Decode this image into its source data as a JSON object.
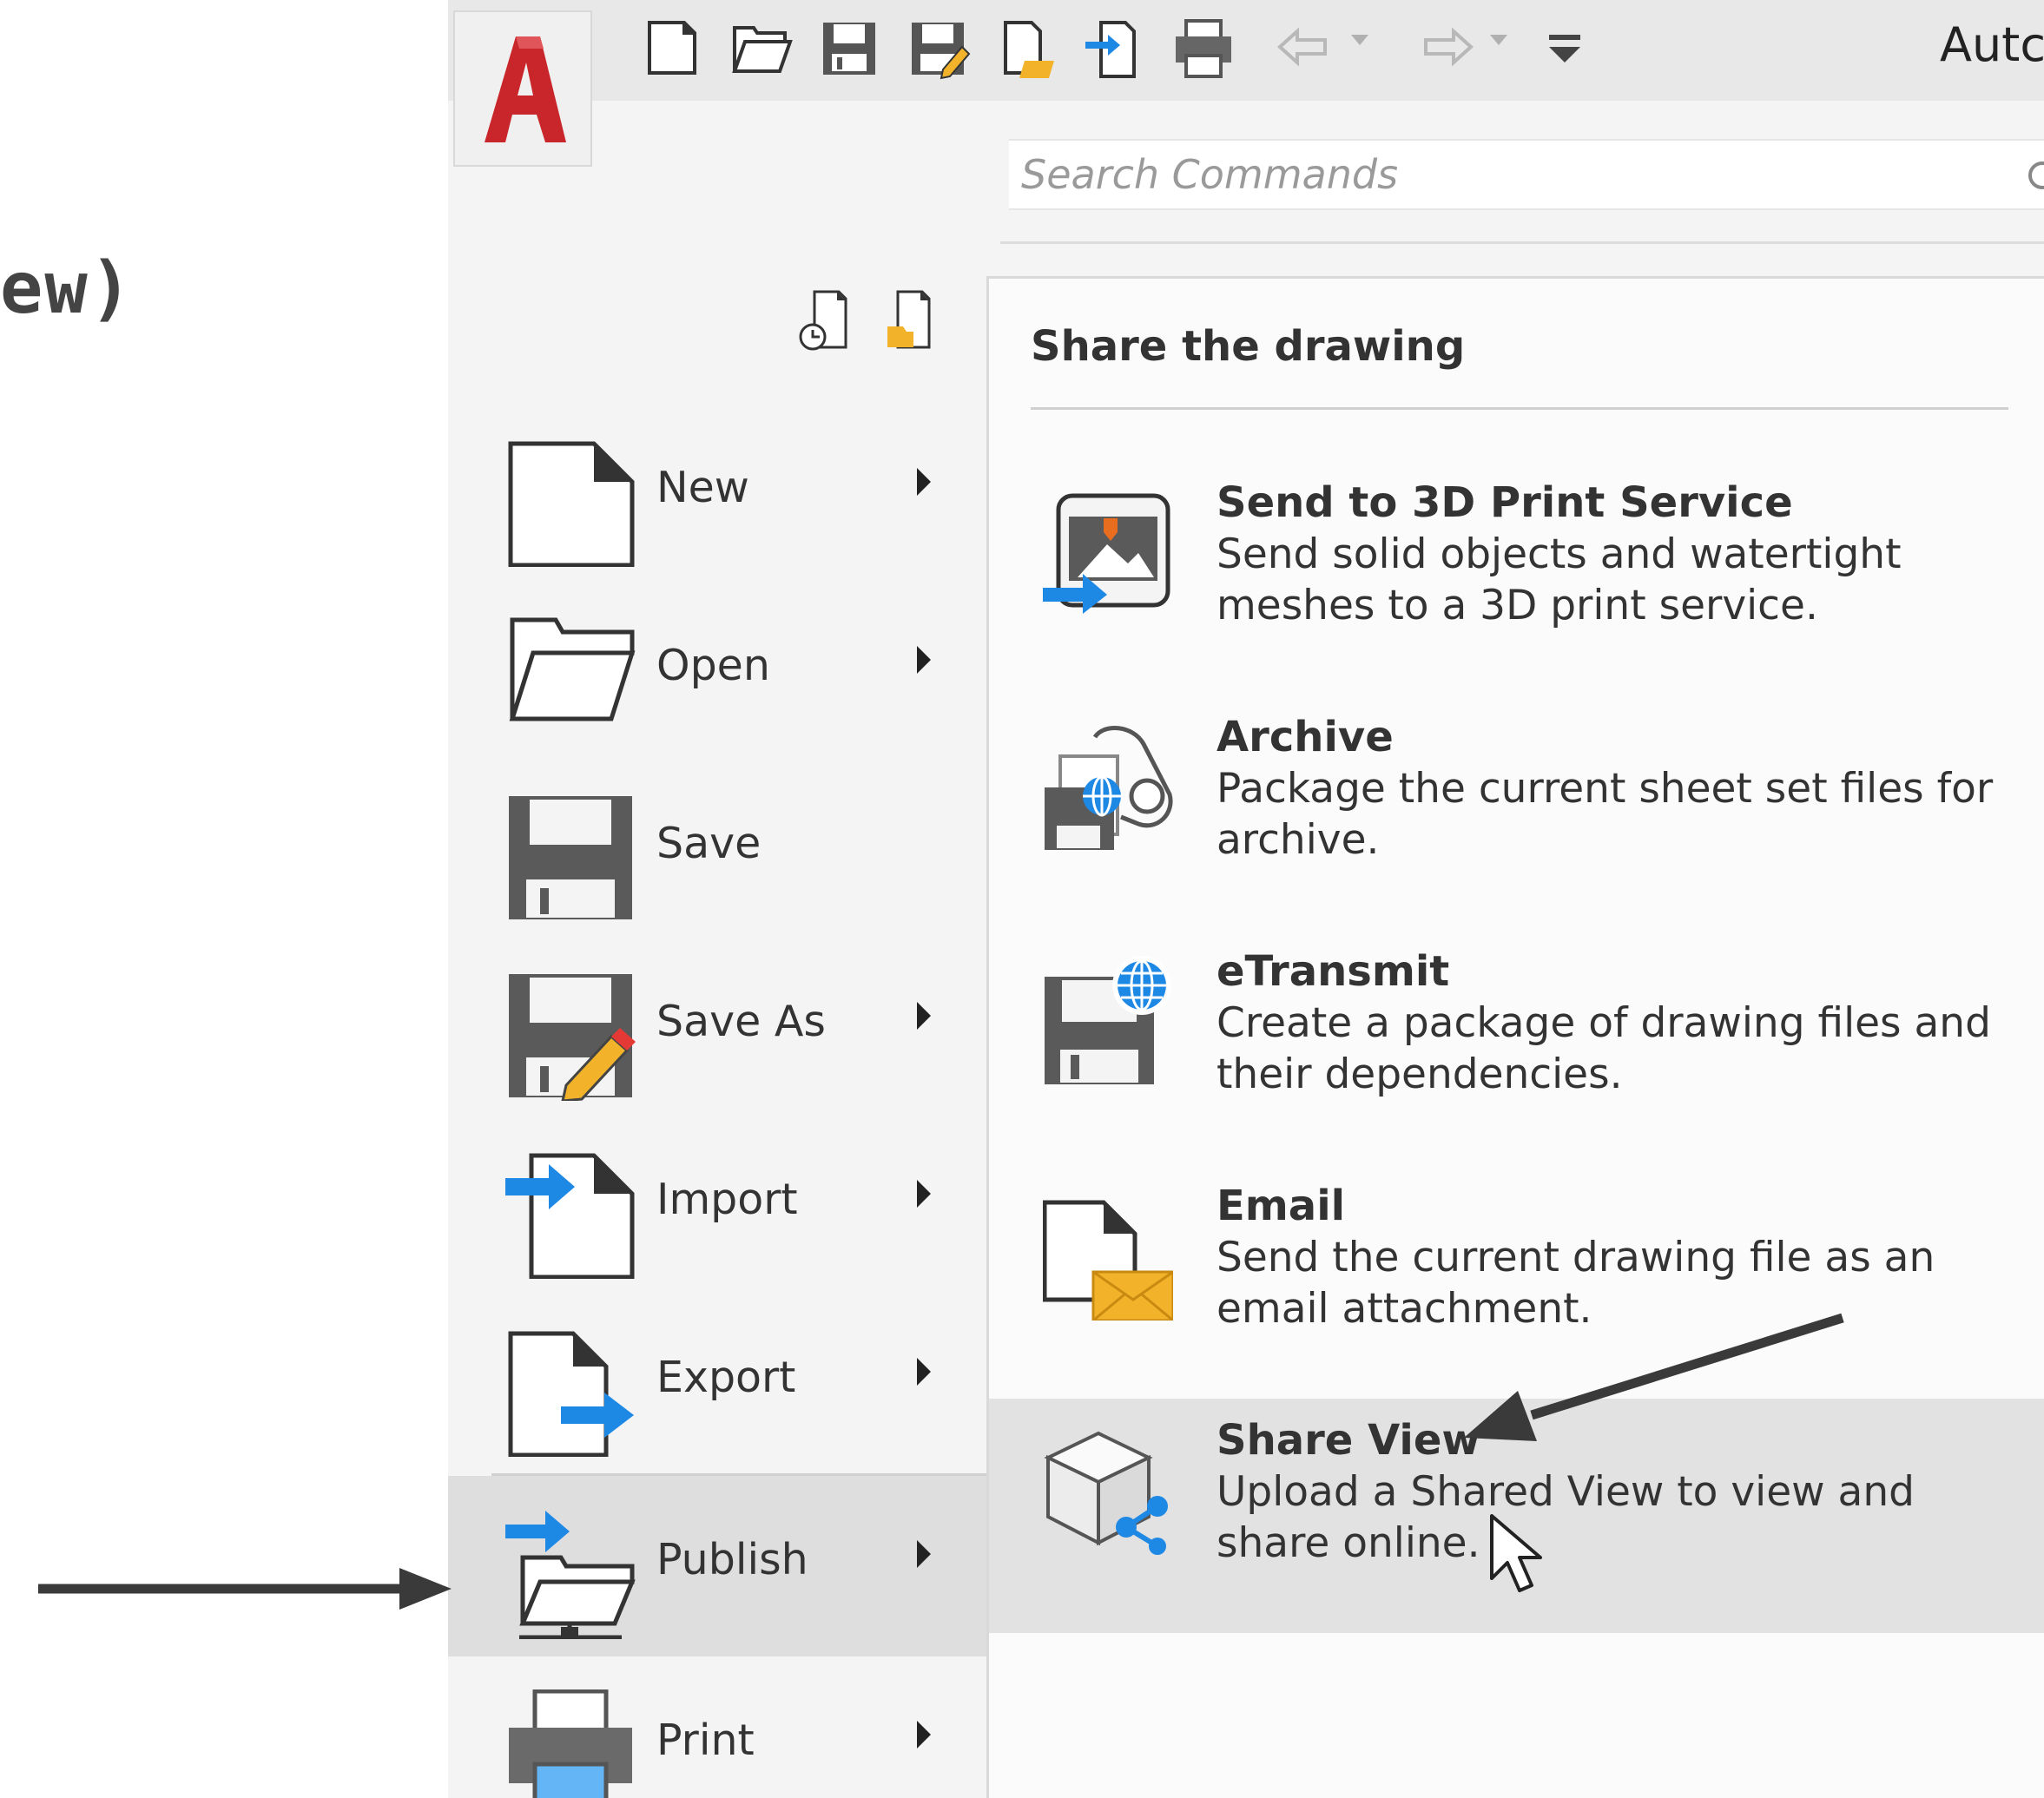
{
  "page_fragment": "ew)",
  "app": {
    "title": "Autc",
    "logo_letter": "A",
    "search": {
      "placeholder": "Search Commands"
    }
  },
  "quick_access": [
    {
      "name": "new-icon"
    },
    {
      "name": "open-icon"
    },
    {
      "name": "save-icon"
    },
    {
      "name": "save-as-icon"
    },
    {
      "name": "open-web-icon"
    },
    {
      "name": "import-icon"
    },
    {
      "name": "print-icon"
    },
    {
      "name": "undo-icon"
    },
    {
      "name": "redo-icon"
    },
    {
      "name": "customize-icon"
    }
  ],
  "left_menu": {
    "items": [
      {
        "label": "New",
        "icon": "new-document-icon",
        "has_submenu": true
      },
      {
        "label": "Open",
        "icon": "open-folder-icon",
        "has_submenu": true
      },
      {
        "label": "Save",
        "icon": "save-disk-icon",
        "has_submenu": false
      },
      {
        "label": "Save As",
        "icon": "save-as-disk-icon",
        "has_submenu": true
      },
      {
        "label": "Import",
        "icon": "import-icon",
        "has_submenu": true
      },
      {
        "label": "Export",
        "icon": "export-icon",
        "has_submenu": true
      },
      {
        "label": "Publish",
        "icon": "publish-icon",
        "has_submenu": true,
        "active": true
      },
      {
        "label": "Print",
        "icon": "print-icon",
        "has_submenu": true
      }
    ]
  },
  "panel": {
    "title": "Share the drawing",
    "options": [
      {
        "title": "Send to 3D Print Service",
        "desc": "Send solid objects and watertight meshes to a 3D print service.",
        "icon": "3d-print-icon"
      },
      {
        "title": "Archive",
        "desc": "Package the current sheet set files for archive.",
        "icon": "archive-icon"
      },
      {
        "title": "eTransmit",
        "desc": "Create a package of drawing files and their dependencies.",
        "icon": "etransmit-icon"
      },
      {
        "title": "Email",
        "desc": "Send the current drawing file as an email attachment.",
        "icon": "email-icon"
      },
      {
        "title": "Share View",
        "desc": "Upload a Shared View to view and share online.",
        "icon": "share-view-icon",
        "hover": true
      }
    ]
  },
  "colors": {
    "accent_blue": "#1e88e5",
    "logo_red": "#c8262a",
    "folder_yellow": "#f2b32a",
    "highlight": "#dedede"
  }
}
